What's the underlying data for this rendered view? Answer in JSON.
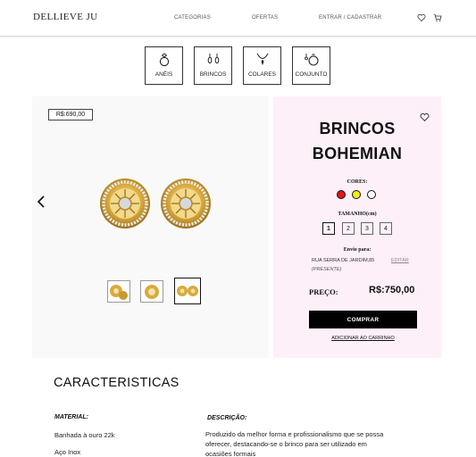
{
  "header": {
    "logo": "DELLIEVE JU",
    "nav": {
      "categorias": "CATEGORIAS",
      "ofertas": "OFERTAS",
      "login": "ENTRAR / CADASTRAR"
    },
    "icons": [
      "heart-icon",
      "cart-icon"
    ]
  },
  "categories": [
    {
      "label": "ANÉIS",
      "icon": "ring-icon"
    },
    {
      "label": "BRINCOS",
      "icon": "earrings-icon"
    },
    {
      "label": "COLARES",
      "icon": "necklace-icon"
    },
    {
      "label": "CONJUNTO",
      "icon": "set-icon"
    }
  ],
  "gallery": {
    "old_price": "R$:690,00",
    "thumbnails_count": 3,
    "active_thumbnail": 3
  },
  "product": {
    "title_line1": "BRINCOS",
    "title_line2": "BOHEMIAN",
    "colors_label": "CORES:",
    "colors": [
      "#e8121b",
      "#f4ee12",
      "#ffffff"
    ],
    "size_label": "TAMANHO(cm)",
    "sizes": [
      "1",
      "2",
      "3",
      "4"
    ],
    "selected_size": "1",
    "shipping_label": "Envio para:",
    "address": "RUA SERRA DE JARDIM,85",
    "edit_label": "EDITAR",
    "gift_note": "(PRESENTE)",
    "price_label": "PREÇO:",
    "price_value": "R$:750,00",
    "buy_label": "COMPRAR",
    "add_to_cart_label": "ADICIONAR AO CARRINHO"
  },
  "characteristics": {
    "title": "CARACTERISTICAS",
    "material_label": "MATERIAL:",
    "materials": [
      "Banhada à ouro 22k",
      "Aço Inox"
    ],
    "description_label": "DESCRIÇÃO:",
    "description": "Produzido da melhor forma e profissionalismo que se possa oferecer, destacando-se o brinco para ser utilizado em ocasiões formais"
  }
}
